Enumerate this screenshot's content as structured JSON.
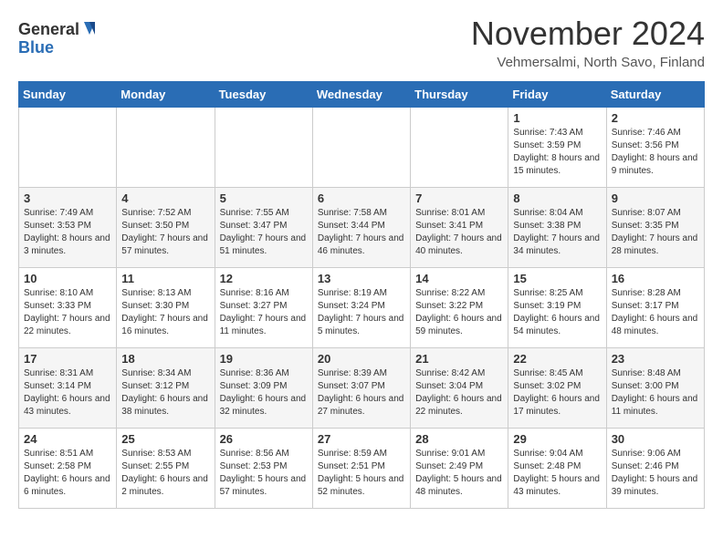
{
  "logo": {
    "general": "General",
    "blue": "Blue"
  },
  "header": {
    "month_title": "November 2024",
    "location": "Vehmersalmi, North Savo, Finland"
  },
  "days_of_week": [
    "Sunday",
    "Monday",
    "Tuesday",
    "Wednesday",
    "Thursday",
    "Friday",
    "Saturday"
  ],
  "weeks": [
    [
      {
        "day": "",
        "info": ""
      },
      {
        "day": "",
        "info": ""
      },
      {
        "day": "",
        "info": ""
      },
      {
        "day": "",
        "info": ""
      },
      {
        "day": "",
        "info": ""
      },
      {
        "day": "1",
        "info": "Sunrise: 7:43 AM\nSunset: 3:59 PM\nDaylight: 8 hours and 15 minutes."
      },
      {
        "day": "2",
        "info": "Sunrise: 7:46 AM\nSunset: 3:56 PM\nDaylight: 8 hours and 9 minutes."
      }
    ],
    [
      {
        "day": "3",
        "info": "Sunrise: 7:49 AM\nSunset: 3:53 PM\nDaylight: 8 hours and 3 minutes."
      },
      {
        "day": "4",
        "info": "Sunrise: 7:52 AM\nSunset: 3:50 PM\nDaylight: 7 hours and 57 minutes."
      },
      {
        "day": "5",
        "info": "Sunrise: 7:55 AM\nSunset: 3:47 PM\nDaylight: 7 hours and 51 minutes."
      },
      {
        "day": "6",
        "info": "Sunrise: 7:58 AM\nSunset: 3:44 PM\nDaylight: 7 hours and 46 minutes."
      },
      {
        "day": "7",
        "info": "Sunrise: 8:01 AM\nSunset: 3:41 PM\nDaylight: 7 hours and 40 minutes."
      },
      {
        "day": "8",
        "info": "Sunrise: 8:04 AM\nSunset: 3:38 PM\nDaylight: 7 hours and 34 minutes."
      },
      {
        "day": "9",
        "info": "Sunrise: 8:07 AM\nSunset: 3:35 PM\nDaylight: 7 hours and 28 minutes."
      }
    ],
    [
      {
        "day": "10",
        "info": "Sunrise: 8:10 AM\nSunset: 3:33 PM\nDaylight: 7 hours and 22 minutes."
      },
      {
        "day": "11",
        "info": "Sunrise: 8:13 AM\nSunset: 3:30 PM\nDaylight: 7 hours and 16 minutes."
      },
      {
        "day": "12",
        "info": "Sunrise: 8:16 AM\nSunset: 3:27 PM\nDaylight: 7 hours and 11 minutes."
      },
      {
        "day": "13",
        "info": "Sunrise: 8:19 AM\nSunset: 3:24 PM\nDaylight: 7 hours and 5 minutes."
      },
      {
        "day": "14",
        "info": "Sunrise: 8:22 AM\nSunset: 3:22 PM\nDaylight: 6 hours and 59 minutes."
      },
      {
        "day": "15",
        "info": "Sunrise: 8:25 AM\nSunset: 3:19 PM\nDaylight: 6 hours and 54 minutes."
      },
      {
        "day": "16",
        "info": "Sunrise: 8:28 AM\nSunset: 3:17 PM\nDaylight: 6 hours and 48 minutes."
      }
    ],
    [
      {
        "day": "17",
        "info": "Sunrise: 8:31 AM\nSunset: 3:14 PM\nDaylight: 6 hours and 43 minutes."
      },
      {
        "day": "18",
        "info": "Sunrise: 8:34 AM\nSunset: 3:12 PM\nDaylight: 6 hours and 38 minutes."
      },
      {
        "day": "19",
        "info": "Sunrise: 8:36 AM\nSunset: 3:09 PM\nDaylight: 6 hours and 32 minutes."
      },
      {
        "day": "20",
        "info": "Sunrise: 8:39 AM\nSunset: 3:07 PM\nDaylight: 6 hours and 27 minutes."
      },
      {
        "day": "21",
        "info": "Sunrise: 8:42 AM\nSunset: 3:04 PM\nDaylight: 6 hours and 22 minutes."
      },
      {
        "day": "22",
        "info": "Sunrise: 8:45 AM\nSunset: 3:02 PM\nDaylight: 6 hours and 17 minutes."
      },
      {
        "day": "23",
        "info": "Sunrise: 8:48 AM\nSunset: 3:00 PM\nDaylight: 6 hours and 11 minutes."
      }
    ],
    [
      {
        "day": "24",
        "info": "Sunrise: 8:51 AM\nSunset: 2:58 PM\nDaylight: 6 hours and 6 minutes."
      },
      {
        "day": "25",
        "info": "Sunrise: 8:53 AM\nSunset: 2:55 PM\nDaylight: 6 hours and 2 minutes."
      },
      {
        "day": "26",
        "info": "Sunrise: 8:56 AM\nSunset: 2:53 PM\nDaylight: 5 hours and 57 minutes."
      },
      {
        "day": "27",
        "info": "Sunrise: 8:59 AM\nSunset: 2:51 PM\nDaylight: 5 hours and 52 minutes."
      },
      {
        "day": "28",
        "info": "Sunrise: 9:01 AM\nSunset: 2:49 PM\nDaylight: 5 hours and 48 minutes."
      },
      {
        "day": "29",
        "info": "Sunrise: 9:04 AM\nSunset: 2:48 PM\nDaylight: 5 hours and 43 minutes."
      },
      {
        "day": "30",
        "info": "Sunrise: 9:06 AM\nSunset: 2:46 PM\nDaylight: 5 hours and 39 minutes."
      }
    ]
  ]
}
